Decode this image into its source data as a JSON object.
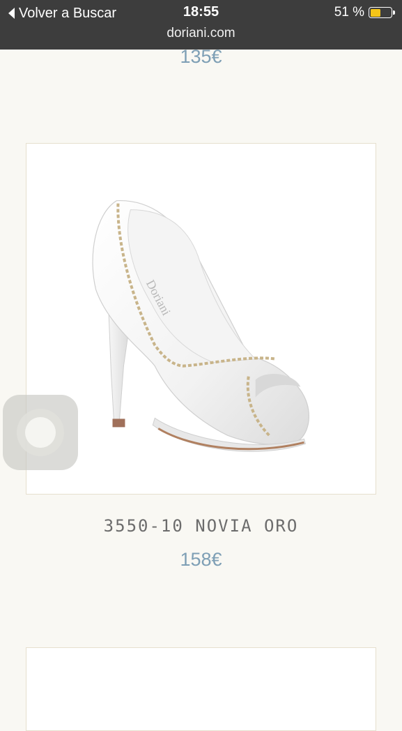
{
  "status_bar": {
    "back_label": "Volver a Buscar",
    "time": "18:55",
    "battery_percent_label": "51 %",
    "battery_level": 0.51,
    "battery_color": "#f5c518",
    "url": "doriani.com"
  },
  "products": {
    "previous_price": "135€",
    "current": {
      "name": "3550-10 NOVIA ORO",
      "price": "158€"
    }
  },
  "colors": {
    "price": "#7e9fb5",
    "background": "#f9f8f3",
    "card_border": "#e6dfce",
    "status_bar": "#3d3d3d"
  },
  "icons": [
    "back-chevron-icon",
    "battery-icon",
    "assistive-touch-icon"
  ]
}
